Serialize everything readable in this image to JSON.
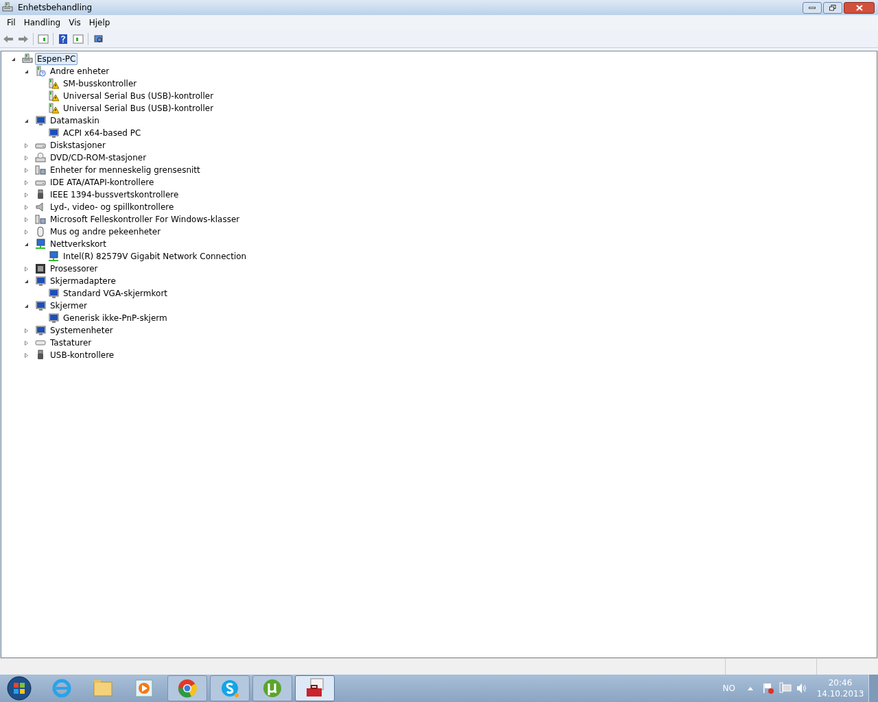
{
  "window": {
    "title": "Enhetsbehandling"
  },
  "menu": [
    "Fil",
    "Handling",
    "Vis",
    "Hjelp"
  ],
  "tree": [
    {
      "label": "Espen-PC",
      "selected": true,
      "expanded": true,
      "children": [
        {
          "label": "Andre enheter",
          "selected": false,
          "expanded": true,
          "children": [
            {
              "label": "SM-busskontroller",
              "selected": false
            },
            {
              "label": "Universal Serial Bus (USB)-kontroller",
              "selected": false
            },
            {
              "label": "Universal Serial Bus (USB)-kontroller",
              "selected": false
            }
          ]
        },
        {
          "label": "Datamaskin",
          "selected": false,
          "expanded": true,
          "children": [
            {
              "label": "ACPI x64-based PC",
              "selected": false
            }
          ]
        },
        {
          "label": "Diskstasjoner",
          "selected": false,
          "expanded": false
        },
        {
          "label": "DVD/CD-ROM-stasjoner",
          "selected": false,
          "expanded": false
        },
        {
          "label": "Enheter for menneskelig grensesnitt",
          "selected": false,
          "expanded": false
        },
        {
          "label": "IDE ATA/ATAPI-kontrollere",
          "selected": false,
          "expanded": false
        },
        {
          "label": "IEEE 1394-bussvertskontrollere",
          "selected": false,
          "expanded": false
        },
        {
          "label": "Lyd-, video- og spillkontrollere",
          "selected": false,
          "expanded": false
        },
        {
          "label": "Microsoft Felleskontroller For Windows-klasser",
          "selected": false,
          "expanded": false
        },
        {
          "label": "Mus og andre pekeenheter",
          "selected": false,
          "expanded": false
        },
        {
          "label": "Nettverkskort",
          "selected": false,
          "expanded": true,
          "children": [
            {
              "label": "Intel(R) 82579V Gigabit Network Connection",
              "selected": false
            }
          ]
        },
        {
          "label": "Prosessorer",
          "selected": false,
          "expanded": false
        },
        {
          "label": "Skjermadaptere",
          "selected": false,
          "expanded": true,
          "children": [
            {
              "label": "Standard VGA-skjermkort",
              "selected": false
            }
          ]
        },
        {
          "label": "Skjermer",
          "selected": false,
          "expanded": true,
          "children": [
            {
              "label": "Generisk ikke-PnP-skjerm",
              "selected": false
            }
          ]
        },
        {
          "label": "Systemenheter",
          "selected": false,
          "expanded": false
        },
        {
          "label": "Tastaturer",
          "selected": false,
          "expanded": false
        },
        {
          "label": "USB-kontrollere",
          "selected": false,
          "expanded": false
        }
      ]
    }
  ],
  "taskbar": {
    "buttons": [
      {
        "selected": false
      },
      {
        "selected": false
      },
      {
        "selected": false
      },
      {
        "selected": true
      }
    ]
  },
  "tray": {
    "language": "NO",
    "time": "20:46",
    "date": "14.10.2013"
  }
}
